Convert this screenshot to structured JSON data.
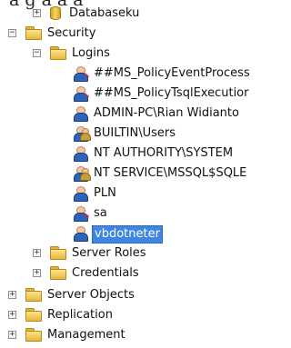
{
  "top_fragment": "a g   a          a    a ",
  "tree": {
    "database_item": "Databaseku",
    "security_folder": "Security",
    "logins_folder": "Logins",
    "logins": [
      {
        "label": "##MS_PolicyEventProcess",
        "icon": "login-disabled-icon"
      },
      {
        "label": "##MS_PolicyTsqlExecutior",
        "icon": "login-disabled-icon"
      },
      {
        "label": "ADMIN-PC\\Rian Widianto",
        "icon": "login-user-icon"
      },
      {
        "label": "BUILTIN\\Users",
        "icon": "login-group-icon"
      },
      {
        "label": "NT AUTHORITY\\SYSTEM",
        "icon": "login-user-icon"
      },
      {
        "label": "NT SERVICE\\MSSQL$SQLE",
        "icon": "login-group-icon"
      },
      {
        "label": "PLN",
        "icon": "login-user-icon"
      },
      {
        "label": "sa",
        "icon": "login-disabled-icon"
      },
      {
        "label": "vbdotneter",
        "icon": "login-user-icon"
      }
    ],
    "server_roles_folder": "Server Roles",
    "credentials_folder": "Credentials",
    "server_objects_folder": "Server Objects",
    "replication_folder": "Replication",
    "management_folder": "Management"
  },
  "expander_symbols": {
    "plus": "+",
    "minus": "−"
  }
}
